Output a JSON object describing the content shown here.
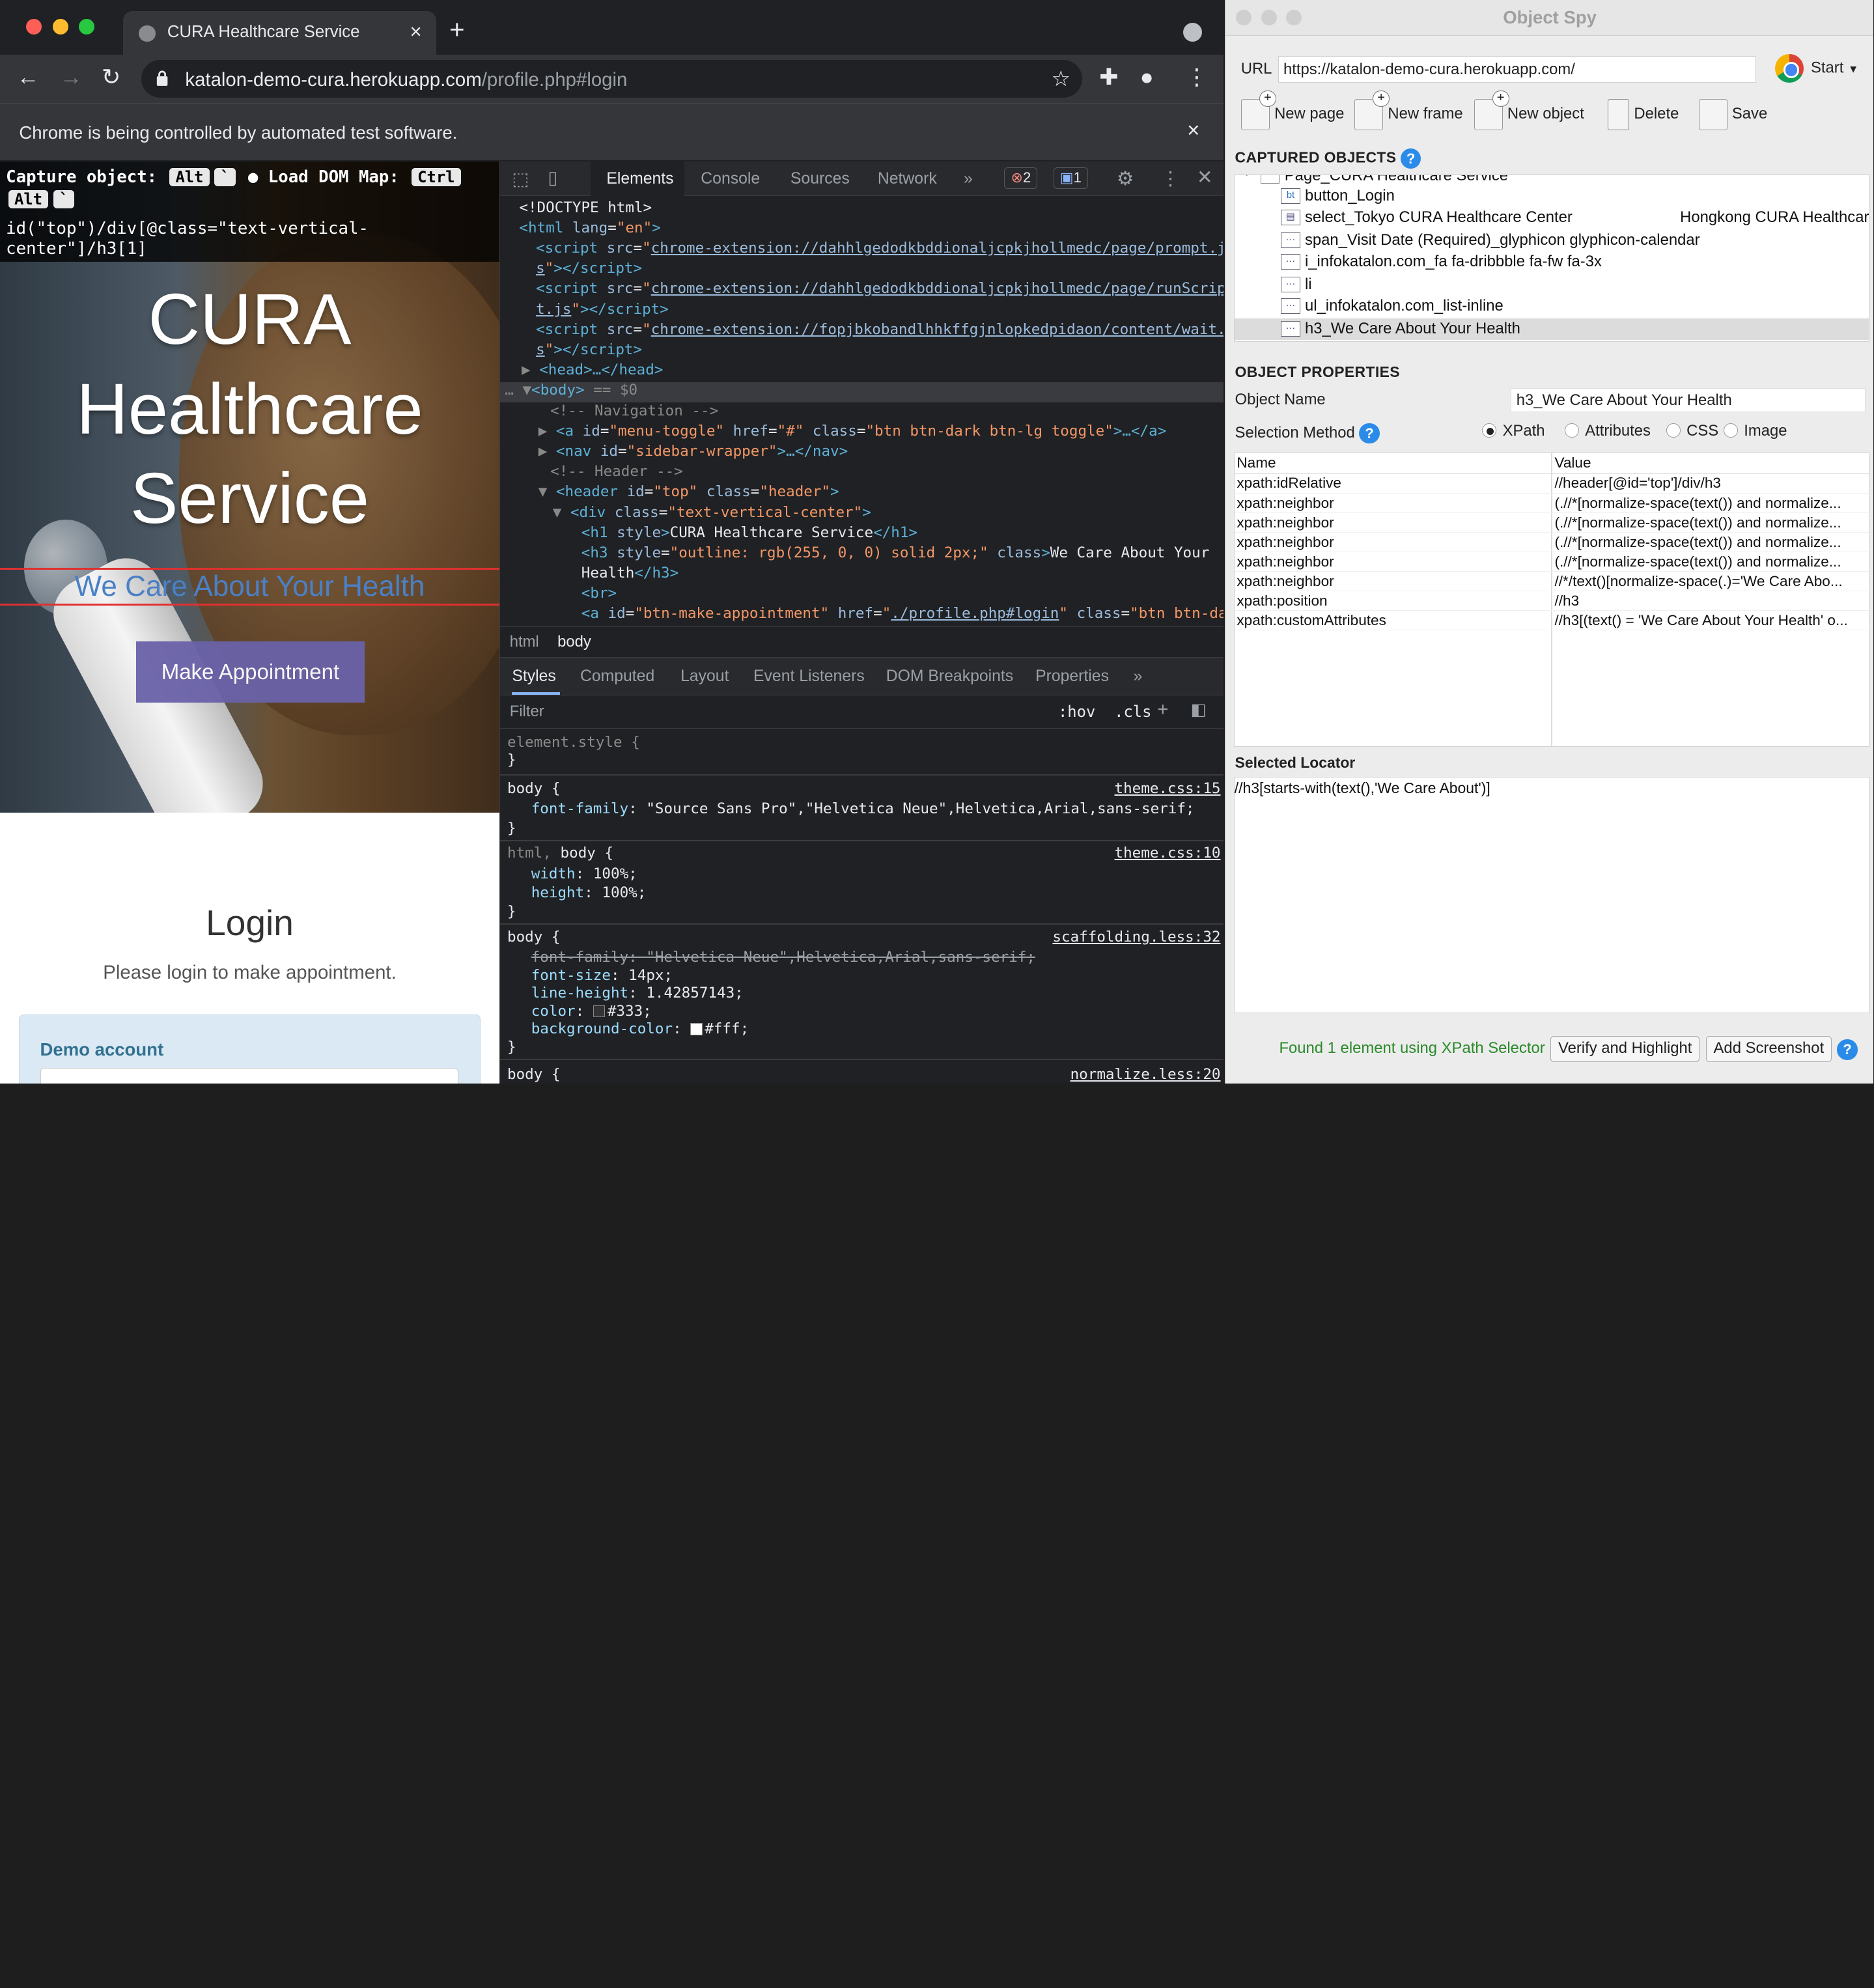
{
  "chrome": {
    "tab_title": "CURA Healthcare Service",
    "tab_close": "×",
    "new_tab": "+",
    "url_host": "katalon-demo-cura.herokuapp.com",
    "url_path": "/profile.php#login",
    "infobar_message": "Chrome is being controlled by automated test software.",
    "infobar_close": "×"
  },
  "page": {
    "capture_label": "Capture object:",
    "capture_key1": "Alt",
    "capture_key2": "`",
    "load_dom_label": "Load DOM Map:",
    "load_key1": "Ctrl",
    "load_key2": "Alt",
    "load_key3": "`",
    "xpath_line1": "id(\"top\")/div[@class=\"text-vertical-",
    "xpath_line2": "center\"]/h3[1]",
    "hero_title_1": "CURA",
    "hero_title_2": "Healthcare",
    "hero_title_3": "Service",
    "slogan": "We Care About Your Health",
    "make_appointment": "Make Appointment",
    "login_title": "Login",
    "login_subtitle": "Please login to make appointment.",
    "demo_account": "Demo account"
  },
  "devtools": {
    "tabs": [
      "Elements",
      "Console",
      "Sources",
      "Network",
      "»"
    ],
    "error_count": "2",
    "message_count": "1",
    "dom": {
      "doctype": "<!DOCTYPE html>",
      "html_open": "lang=\"en\"",
      "script1_src": "chrome-extension://dahhlgedodkbddionaljcpkjhollmedc/page/prompt.j",
      "script1_tail": "s",
      "script2_src": "chrome-extension://dahhlgedodkbddionaljcpkjhollmedc/page/runScrip",
      "script2_tail": "t.js",
      "script3_src": "chrome-extension://fopjbkobandlhhkffgjnlopkedpidaon/content/wait.j",
      "script3_tail": "s",
      "head": "<head>…</head>",
      "body_open": "<body>",
      "body_sel": "== $0",
      "comment_nav": "<!-- Navigation -->",
      "menu_toggle_id": "\"menu-toggle\"",
      "menu_toggle_href": "\"#\"",
      "menu_toggle_class": "\"btn btn-dark btn-lg toggle\"",
      "nav_id": "\"sidebar-wrapper\"",
      "comment_header": "<!-- Header -->",
      "header_id": "\"top\"",
      "header_class": "\"header\"",
      "div_class": "\"text-vertical-center\"",
      "h1_text": "CURA Healthcare Service",
      "h3_style": "\"outline: rgb(255, 0, 0) solid 2px;\"",
      "h3_text_1": "We Care About Your",
      "h3_text_2": "Health",
      "a_id": "\"btn-make-appointment\"",
      "a_href": "./profile.php#login",
      "a_class": "\"btn btn-dar"
    },
    "breadcrumbs": [
      "html",
      "body"
    ],
    "subtabs": [
      "Styles",
      "Computed",
      "Layout",
      "Event Listeners",
      "DOM Breakpoints",
      "Properties",
      "»"
    ],
    "filter_placeholder": "Filter",
    "hov": ":hov",
    "cls": ".cls",
    "styles": {
      "element_style": "element.style {",
      "r1_sel": "body {",
      "r1_src": "theme.css:15",
      "r1_prop": "font-family",
      "r1_val": "\"Source Sans Pro\",\"Helvetica Neue\",Helvetica,Arial,sans-serif;",
      "r2_sel_a": "html,",
      "r2_sel_b": "body {",
      "r2_src": "theme.css:10",
      "r2_p1": "width",
      "r2_v1": "100%;",
      "r2_p2": "height",
      "r2_v2": "100%;",
      "r3_sel": "body {",
      "r3_src": "scaffolding.less:32",
      "r3_strike": "font-family: \"Helvetica Neue\",Helvetica,Arial,sans-serif;",
      "r3_p1": "font-size",
      "r3_v1": "14px;",
      "r3_p2": "line-height",
      "r3_v2": "1.42857143;",
      "r3_p3": "color",
      "r3_v3": "#333;",
      "r3_p4": "background-color",
      "r3_v4": "#fff;",
      "r4_sel": "body {",
      "r4_src": "normalize.less:20",
      "close": "}"
    }
  },
  "spy": {
    "title": "Object Spy",
    "url_label": "URL",
    "url_value": "https://katalon-demo-cura.herokuapp.com/",
    "start_label": "Start",
    "toolbar": [
      "New page",
      "New frame",
      "New object",
      "Delete",
      "Save"
    ],
    "captured_title": "CAPTURED OBJECTS",
    "tree_root": "Page_CURA Healthcare Service",
    "tree_items": [
      {
        "icon": "bt",
        "label": "button_Login"
      },
      {
        "icon": "▤",
        "label": "select_Tokyo CURA Healthcare Center",
        "extra": "Hongkong CURA Healthcare"
      },
      {
        "icon": "···",
        "label": "span_Visit Date (Required)_glyphicon glyphicon-calendar"
      },
      {
        "icon": "···",
        "label": "i_infokatalon.com_fa fa-dribbble fa-fw fa-3x"
      },
      {
        "icon": "···",
        "label": "li"
      },
      {
        "icon": "···",
        "label": "ul_infokatalon.com_list-inline"
      },
      {
        "icon": "···",
        "label": "h3_We Care About Your Health"
      }
    ],
    "props_title": "OBJECT PROPERTIES",
    "object_name_label": "Object Name",
    "object_name_value": "h3_We Care About Your Health",
    "selection_method_label": "Selection Method",
    "methods": [
      "XPath",
      "Attributes",
      "CSS",
      "Image"
    ],
    "table_headers": [
      "Name",
      "Value"
    ],
    "table_rows": [
      {
        "name": "xpath:idRelative",
        "value": "//header[@id='top']/div/h3"
      },
      {
        "name": "xpath:neighbor",
        "value": "(.//*[normalize-space(text()) and normalize..."
      },
      {
        "name": "xpath:neighbor",
        "value": "(.//*[normalize-space(text()) and normalize..."
      },
      {
        "name": "xpath:neighbor",
        "value": "(.//*[normalize-space(text()) and normalize..."
      },
      {
        "name": "xpath:neighbor",
        "value": "(.//*[normalize-space(text()) and normalize..."
      },
      {
        "name": "xpath:neighbor",
        "value": "//*/text()[normalize-space(.)='We Care Abo..."
      },
      {
        "name": "xpath:position",
        "value": "//h3"
      },
      {
        "name": "xpath:customAttributes",
        "value": "//h3[(text() = 'We Care About Your Health' o..."
      }
    ],
    "selected_locator_title": "Selected Locator",
    "selected_locator": "//h3[starts-with(text(),'We Care About')]",
    "found_text": "Found 1 element using XPath Selector",
    "verify_button": "Verify and Highlight",
    "screenshot_button": "Add Screenshot",
    "help": "?"
  },
  "colors": {
    "chrome_bg": "#202124",
    "accent_purple": "#6a62a8",
    "highlight_red": "#e03030",
    "spy_green": "#2a8a2a",
    "help_blue": "#2b8be8"
  }
}
